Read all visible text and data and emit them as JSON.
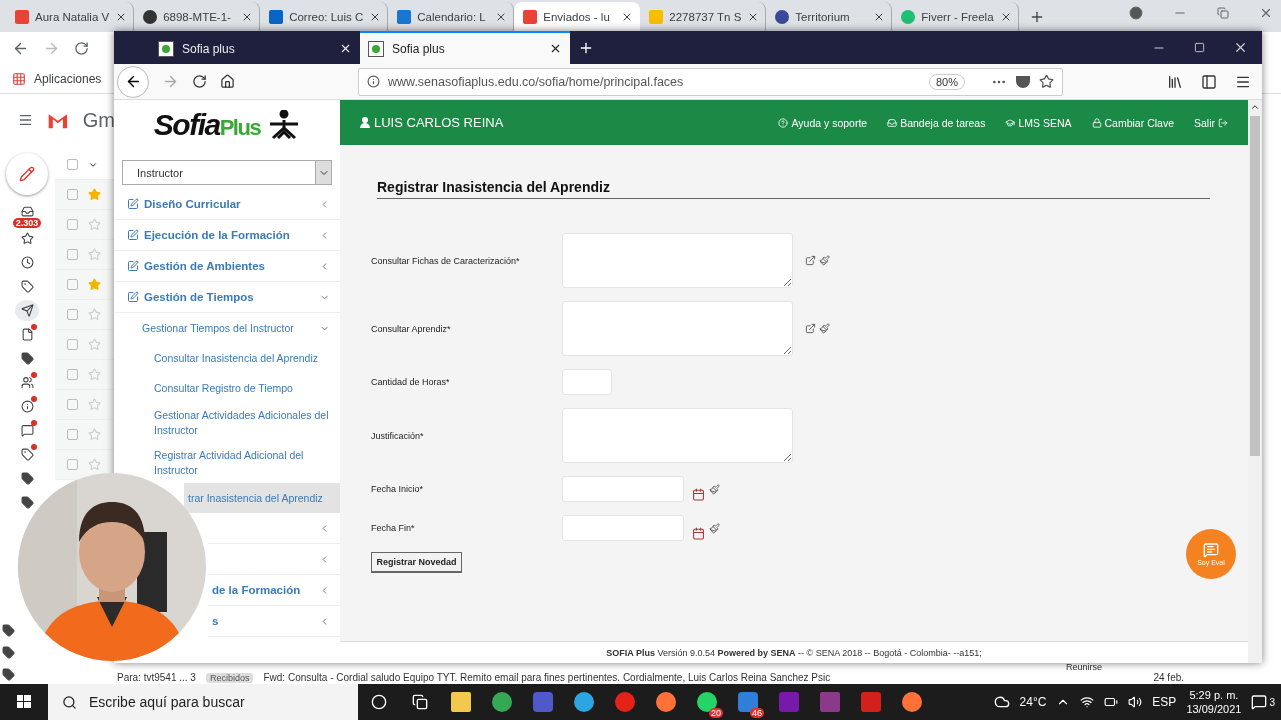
{
  "chrome": {
    "tabs": [
      {
        "title": "Aura Natalia V",
        "kind": "gmail",
        "selected": false
      },
      {
        "title": "6898-MTE-1-",
        "kind": "moodle",
        "selected": false
      },
      {
        "title": "Correo: Luis C",
        "kind": "outlook",
        "selected": false
      },
      {
        "title": "Calendario: L",
        "kind": "calendar",
        "selected": false
      },
      {
        "title": "Enviados - lu",
        "kind": "gmail",
        "selected": true
      },
      {
        "title": "2278737 Tn S",
        "kind": "drive",
        "selected": false
      },
      {
        "title": "Territorium",
        "kind": "eye",
        "selected": false
      },
      {
        "title": "Fiverr - Freela",
        "kind": "fiverr",
        "selected": false
      }
    ],
    "bookmarks": [
      "Aplicaciones"
    ]
  },
  "gmail": {
    "logo_text": "Gm",
    "select_all": {
      "checked": false
    },
    "nav_icons": [
      {
        "kind": "inbox",
        "badge": "2.303",
        "selected": false,
        "dot": false
      },
      {
        "kind": "star",
        "selected": false,
        "dot": false
      },
      {
        "kind": "clock",
        "selected": false,
        "dot": false
      },
      {
        "kind": "label",
        "selected": false,
        "dot": false
      },
      {
        "kind": "send",
        "selected": true,
        "dot": false
      },
      {
        "kind": "file",
        "selected": false,
        "dot": true
      },
      {
        "kind": "tag",
        "selected": false,
        "dot": false
      },
      {
        "kind": "people",
        "selected": false,
        "dot": true
      },
      {
        "kind": "info",
        "selected": false,
        "dot": true
      },
      {
        "kind": "chat",
        "selected": false,
        "dot": true
      },
      {
        "kind": "tagline",
        "selected": false,
        "dot": true
      },
      {
        "kind": "tag",
        "selected": false,
        "dot": false
      },
      {
        "kind": "tag",
        "selected": false,
        "dot": false
      }
    ],
    "nav_icons_lower": [
      {
        "kind": "tag"
      },
      {
        "kind": "tag"
      },
      {
        "kind": "tag"
      }
    ],
    "rows": [
      {
        "starred": true,
        "checked": false
      },
      {
        "starred": false,
        "checked": false
      },
      {
        "starred": false,
        "checked": false
      },
      {
        "starred": true,
        "checked": false
      },
      {
        "starred": false,
        "checked": false
      },
      {
        "starred": false,
        "checked": false
      },
      {
        "starred": false,
        "checked": false
      },
      {
        "starred": false,
        "checked": false
      },
      {
        "starred": false,
        "checked": false
      },
      {
        "starred": false,
        "checked": false
      }
    ],
    "bottom_row": {
      "from": "Para: tvt9541 ... 3",
      "tag": "Recibidos",
      "subject": "Fwd: Consulta - Cordial saludo Equipo TYT. Remito email para fines pertinentes. Cordialmente, Luis Carlos Reina Sanchez Psic",
      "date": "24 feb."
    },
    "side_text": "Reunirse"
  },
  "firefox": {
    "tabs": [
      {
        "title": "Sofia plus",
        "selected": false
      },
      {
        "title": "Sofia plus",
        "selected": true
      }
    ],
    "url": "www.senasofiaplus.edu.co/sofia/home/principal.faces",
    "zoom": "80%"
  },
  "site": {
    "logo": {
      "word": "Sofia",
      "accent": "Plus"
    },
    "user": "LUIS CARLOS REINA",
    "links": [
      {
        "label": "Ayuda y soporte",
        "kind": "help"
      },
      {
        "label": "Bandeja de tareas",
        "kind": "tray"
      },
      {
        "label": "LMS SENA",
        "kind": "cap"
      },
      {
        "label": "Cambiar Clave",
        "kind": "lock"
      },
      {
        "label": "Salir",
        "kind": "exit"
      }
    ],
    "role": "Instructor",
    "menu": [
      {
        "label": "Diseño Curricular",
        "expanded": false
      },
      {
        "label": "Ejecución de la Formación",
        "expanded": false
      },
      {
        "label": "Gestión de Ambientes",
        "expanded": false
      },
      {
        "label": "Gestión de Tiempos",
        "expanded": true,
        "children": [
          {
            "label": "Gestionar Tiempos del Instructor",
            "expanded": true,
            "children": [
              {
                "label": "Consultar Inasistencia del Aprendiz",
                "selected": false
              },
              {
                "label": "Consultar Registro de Tiempo",
                "selected": false
              },
              {
                "label": "Gestionar Actividades Adicionales del Instructor",
                "selected": false
              },
              {
                "label": "Registrar Actividad Adicional del Instructor",
                "selected": false
              },
              {
                "label": "trar Inasistencia del Aprendiz",
                "selected": true
              }
            ]
          }
        ]
      },
      {
        "expanded": false
      },
      {
        "expanded": false
      },
      {
        "label": "de la Formación",
        "expanded": false
      },
      {
        "label": "s",
        "expanded": false
      }
    ],
    "form": {
      "title": "Registrar Inasistencia del Aprendiz",
      "fields": [
        {
          "label": "Consultar Fichas de Caracterización*",
          "kind": "textarea",
          "lookup": true
        },
        {
          "label": "Consultar Aprendiz*",
          "kind": "textarea",
          "lookup": true
        },
        {
          "label": "Cantidad de Horas*",
          "kind": "short"
        },
        {
          "label": "Justificación*",
          "kind": "textarea",
          "lookup": false
        },
        {
          "label": "Fecha Inicio*",
          "kind": "date"
        },
        {
          "label": "Fecha Fin*",
          "kind": "date"
        }
      ],
      "submit": "Registrar Novedad"
    },
    "footer": "**SOFIA Plus** Versión 9.0.54 **Powered by SENA** -- © SENA 2018 -- Bogotá - Colombia- --a151;",
    "eval_button": "Soy Eval"
  },
  "taskbar": {
    "search": "Escribe aquí para buscar",
    "apps": [
      {
        "kind": "folder"
      },
      {
        "kind": "chrome"
      },
      {
        "kind": "teams"
      },
      {
        "kind": "telegram"
      },
      {
        "kind": "youtube"
      },
      {
        "kind": "firefox"
      },
      {
        "kind": "whatsapp",
        "badge": "20"
      },
      {
        "kind": "mail",
        "badge": "46"
      },
      {
        "kind": "onenote"
      },
      {
        "kind": "winrar"
      },
      {
        "kind": "acrobat"
      },
      {
        "kind": "firefox"
      }
    ],
    "temperature": "24°C",
    "language": "ESP",
    "time": "5:29 p. m.",
    "date": "13/09/2021",
    "notifications": "3"
  }
}
